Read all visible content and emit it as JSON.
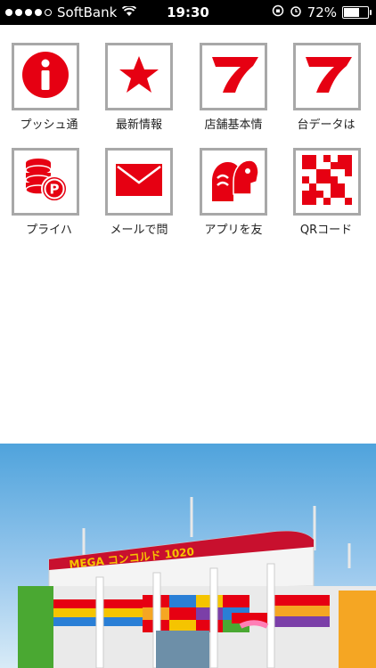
{
  "status_bar": {
    "carrier": "SoftBank",
    "time": "19:30",
    "battery_percent": "72%",
    "signal_bars": 4,
    "battery_level": 0.72
  },
  "menu": [
    {
      "label": "プッシュ通",
      "icon": "info-icon"
    },
    {
      "label": "最新情報",
      "icon": "star-icon"
    },
    {
      "label": "店舗基本情",
      "icon": "seven-icon"
    },
    {
      "label": "台データは",
      "icon": "seven-icon"
    },
    {
      "label": "プライハ",
      "icon": "coins-icon"
    },
    {
      "label": "メールで問",
      "icon": "mail-icon"
    },
    {
      "label": "アプリを友",
      "icon": "share-people-icon"
    },
    {
      "label": "QRコード",
      "icon": "qr-icon"
    }
  ],
  "banner": {
    "sign_text": "MEGA コンコルド 1020"
  },
  "colors": {
    "accent": "#e60012",
    "tile_border": "#a8a8a8"
  }
}
